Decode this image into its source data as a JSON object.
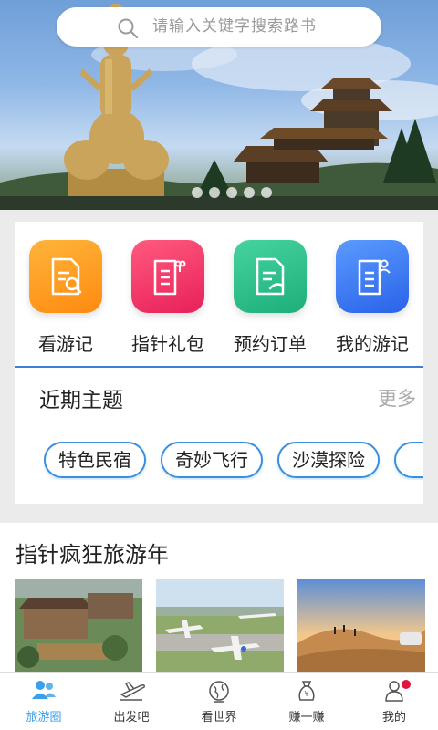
{
  "search": {
    "placeholder": "请输入关键字搜索路书"
  },
  "banner": {
    "slide_count": 5
  },
  "quick_actions": [
    {
      "label": "看游记",
      "icon": "doc-search-icon",
      "color": "#ff9a1f"
    },
    {
      "label": "指针礼包",
      "icon": "gift-doc-icon",
      "color": "#f03a6a"
    },
    {
      "label": "预约订单",
      "icon": "order-doc-icon",
      "color": "#2ec08d"
    },
    {
      "label": "我的游记",
      "icon": "user-doc-icon",
      "color": "#3a7ff0"
    }
  ],
  "themes": {
    "title": "近期主题",
    "more": "更多",
    "tags": [
      "特色民宿",
      "奇妙飞行",
      "沙漠探险"
    ]
  },
  "section": {
    "title": "指针疯狂旅游年"
  },
  "tabbar": {
    "items": [
      {
        "label": "旅游圈",
        "icon": "people-icon",
        "active": true
      },
      {
        "label": "出发吧",
        "icon": "airplane-icon",
        "active": false
      },
      {
        "label": "看世界",
        "icon": "globe-icon",
        "active": false
      },
      {
        "label": "赚一赚",
        "icon": "money-bag-icon",
        "active": false
      },
      {
        "label": "我的",
        "icon": "user-icon",
        "active": false,
        "badge": true
      }
    ]
  },
  "colors": {
    "accent": "#3aa0ea",
    "tag_border": "#3b8fe0",
    "badge": "#e0143c"
  }
}
